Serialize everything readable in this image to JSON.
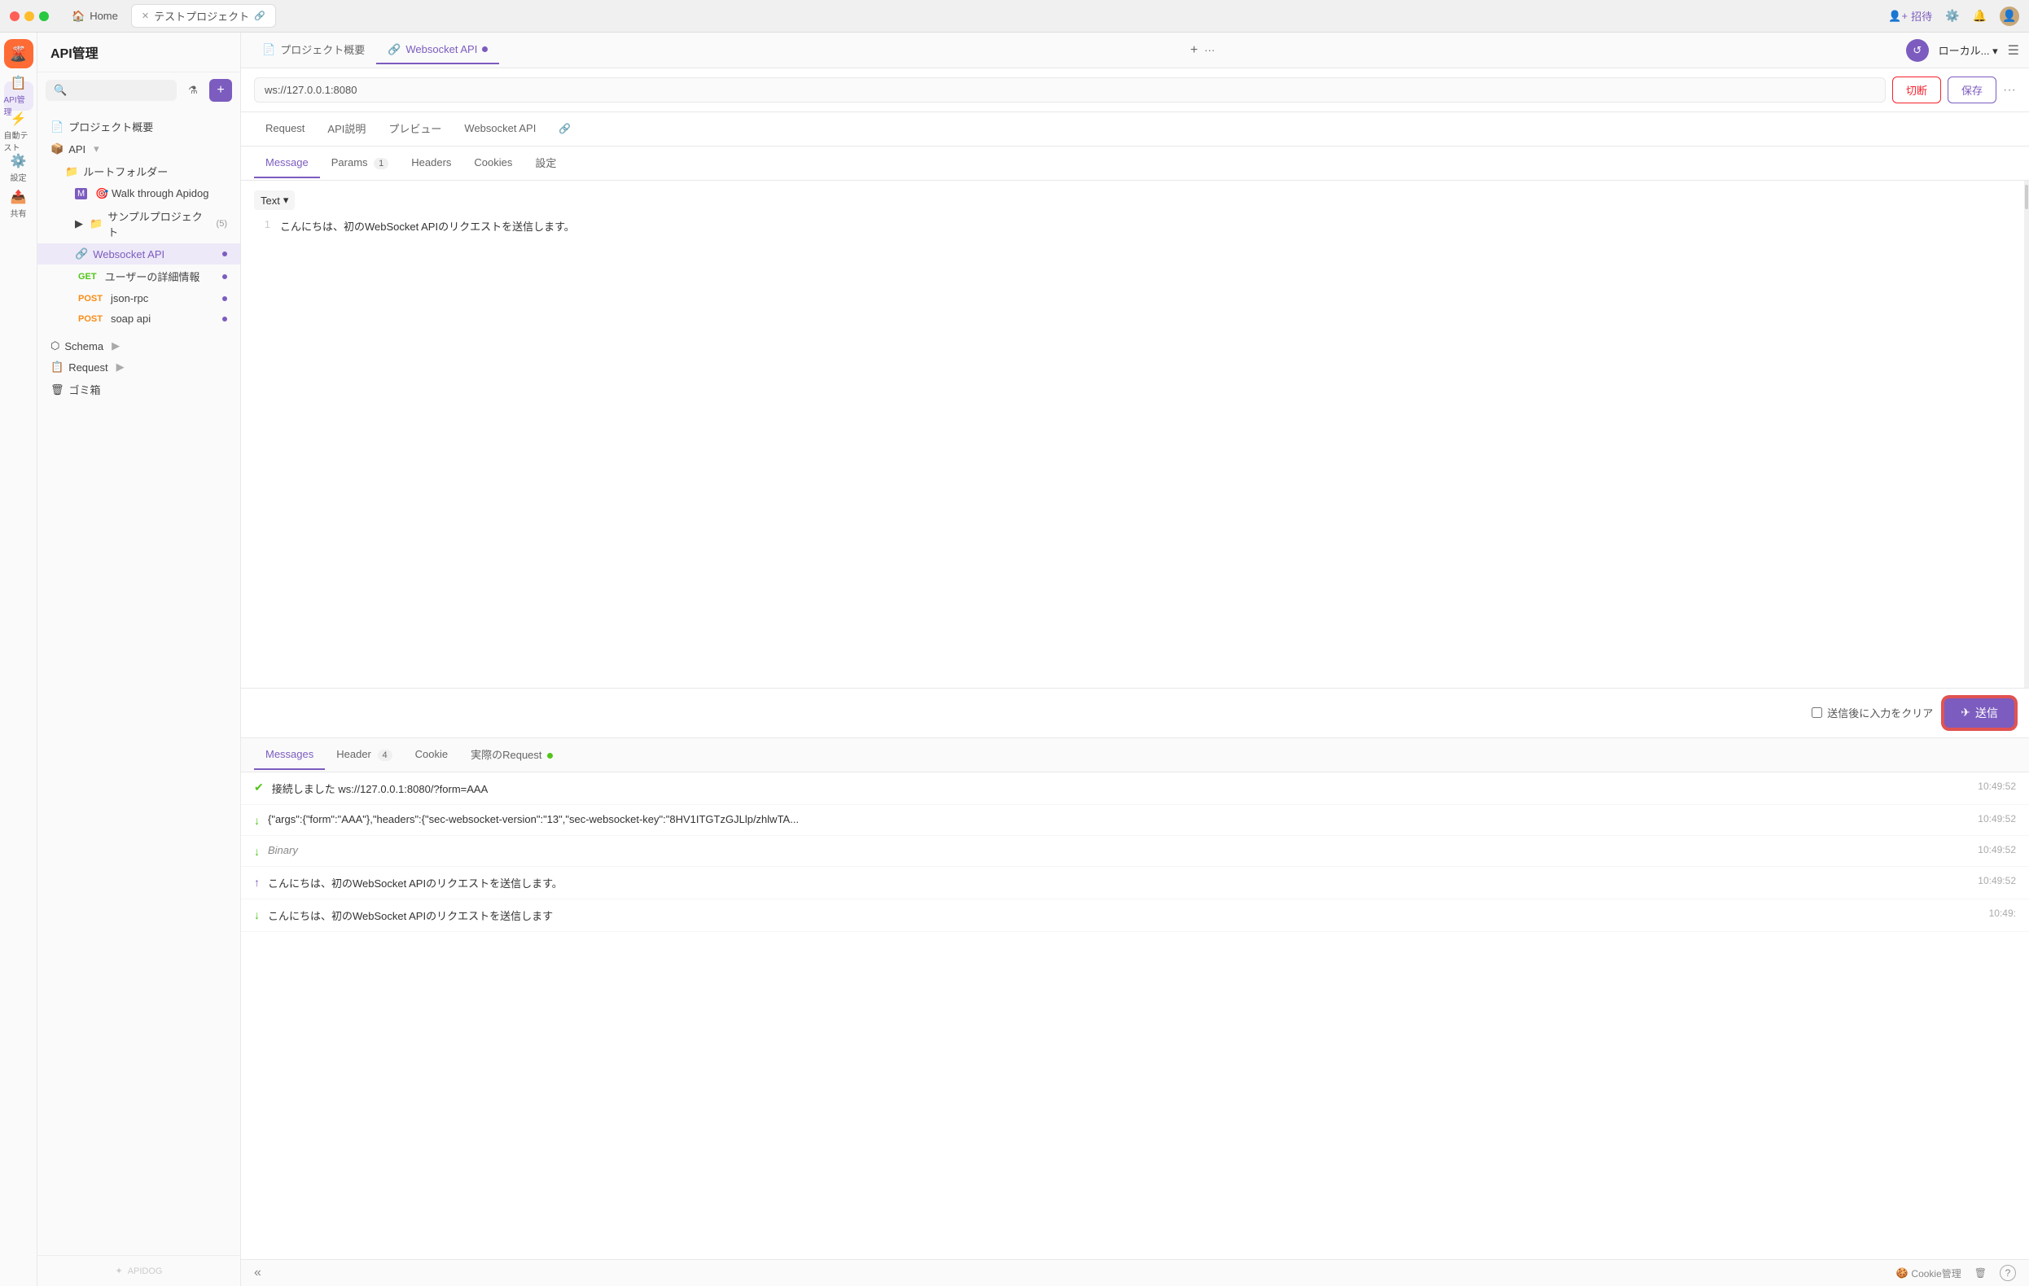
{
  "titleBar": {
    "tabs": [
      {
        "id": "home",
        "label": "Home",
        "active": false,
        "closable": false
      },
      {
        "id": "project",
        "label": "テストプロジェクト",
        "active": true,
        "closable": true
      }
    ],
    "right": {
      "invite": "招待",
      "settings_icon": "gear",
      "notification_icon": "bell",
      "avatar_icon": "person"
    }
  },
  "sidebar": {
    "items": [
      {
        "id": "api",
        "label": "API管理",
        "icon": "📋",
        "active": true
      },
      {
        "id": "autotest",
        "label": "自動テスト",
        "icon": "⚙",
        "active": false
      },
      {
        "id": "settings",
        "label": "設定",
        "icon": "⚙",
        "active": false
      },
      {
        "id": "shared",
        "label": "共有",
        "icon": "📤",
        "active": false
      }
    ]
  },
  "navPanel": {
    "title": "API管理",
    "search_placeholder": "",
    "tree": [
      {
        "id": "project-overview",
        "label": "プロジェクト概要",
        "indent": 0,
        "icon": "📄",
        "type": "item"
      },
      {
        "id": "api-section",
        "label": "API",
        "indent": 0,
        "icon": "📦",
        "type": "section",
        "expandable": true
      },
      {
        "id": "root-folder",
        "label": "ルートフォルダー",
        "indent": 1,
        "icon": "📁",
        "type": "folder"
      },
      {
        "id": "walkthrough",
        "label": "🎯 Walk through Apidog",
        "indent": 2,
        "icon": "M",
        "type": "file"
      },
      {
        "id": "sample-project",
        "label": "サンプルプロジェクト",
        "indent": 2,
        "icon": "📁",
        "type": "folder",
        "badge": "(5)",
        "expandable": true
      },
      {
        "id": "websocket-api",
        "label": "Websocket API",
        "indent": 2,
        "icon": "🔗",
        "type": "api",
        "active": true,
        "dot": true
      },
      {
        "id": "get-user",
        "label": "ユーザーの詳細情報",
        "indent": 2,
        "method": "GET",
        "type": "api",
        "dot": true
      },
      {
        "id": "post-json",
        "label": "json-rpc",
        "indent": 2,
        "method": "POST",
        "type": "api",
        "dot": true
      },
      {
        "id": "post-soap",
        "label": "soap api",
        "indent": 2,
        "method": "POST",
        "type": "api",
        "dot": true
      }
    ],
    "schema": {
      "label": "Schema",
      "icon": "⬡",
      "expandable": true
    },
    "request": {
      "label": "Request",
      "icon": "📋",
      "expandable": true
    },
    "trash": {
      "label": "ゴミ箱",
      "icon": "🗑"
    },
    "watermark": "APIDOG"
  },
  "mainContent": {
    "topTabs": [
      {
        "id": "overview",
        "label": "プロジェクト概要",
        "icon": "📄",
        "active": false
      },
      {
        "id": "websocket",
        "label": "Websocket API",
        "icon": "🔗",
        "active": true,
        "dot": true
      }
    ],
    "topTabsRight": {
      "add_icon": "+",
      "more_icon": "···"
    },
    "urlBar": {
      "url": "ws://127.0.0.1:8080",
      "disconnect_btn": "切断",
      "save_btn": "保存",
      "more": "···"
    },
    "reqTabs": [
      {
        "id": "request",
        "label": "Request",
        "active": false
      },
      {
        "id": "api-desc",
        "label": "API説明",
        "active": false
      },
      {
        "id": "preview",
        "label": "プレビュー",
        "active": false
      },
      {
        "id": "websocket",
        "label": "Websocket API",
        "active": false
      },
      {
        "id": "link",
        "label": "🔗",
        "active": false
      }
    ],
    "messageTabs": [
      {
        "id": "message",
        "label": "Message",
        "active": true
      },
      {
        "id": "params",
        "label": "Params",
        "badge": "1",
        "active": false
      },
      {
        "id": "headers",
        "label": "Headers",
        "active": false
      },
      {
        "id": "cookies",
        "label": "Cookies",
        "active": false
      },
      {
        "id": "settings",
        "label": "設定",
        "active": false
      }
    ],
    "editor": {
      "typeSelector": "Text",
      "lines": [
        {
          "num": 1,
          "content": "こんにちは、初のWebSocket APIのリクエストを送信します。"
        }
      ]
    },
    "sendBar": {
      "clear_label": "送信後に入力をクリア",
      "send_btn": "送信"
    },
    "responseTabs": [
      {
        "id": "messages",
        "label": "Messages",
        "active": true
      },
      {
        "id": "header",
        "label": "Header",
        "badge": "4",
        "active": false
      },
      {
        "id": "cookie",
        "label": "Cookie",
        "active": false
      },
      {
        "id": "actual-request",
        "label": "実際のRequest",
        "active": false,
        "dot": true
      }
    ],
    "responseItems": [
      {
        "type": "connected",
        "icon": "✓",
        "text": "接続しました ws://127.0.0.1:8080/?form=AAA",
        "time": "10:49:52"
      },
      {
        "type": "down",
        "icon": "↓",
        "text": "{\"args\":{\"form\":\"AAA\"},\"headers\":{\"sec-websocket-version\":\"13\",\"sec-websocket-key\":\"8HV1ITGTzGJLlp/zhlwTA...",
        "time": "10:49:52"
      },
      {
        "type": "down",
        "icon": "↓",
        "text": "Binary",
        "italic": true,
        "time": "10:49:52"
      },
      {
        "type": "up",
        "icon": "↑",
        "text": "こんにちは、初のWebSocket APIのリクエストを送信します。",
        "time": "10:49:52"
      },
      {
        "type": "down",
        "icon": "↓",
        "text": "こんにちは、初のWebSocket APIのリクエストを送信します",
        "time": "10:49:"
      }
    ]
  },
  "footer": {
    "collapse_icon": "«",
    "cookie_management": "Cookie管理",
    "delete_icon": "🗑",
    "help_icon": "?"
  }
}
